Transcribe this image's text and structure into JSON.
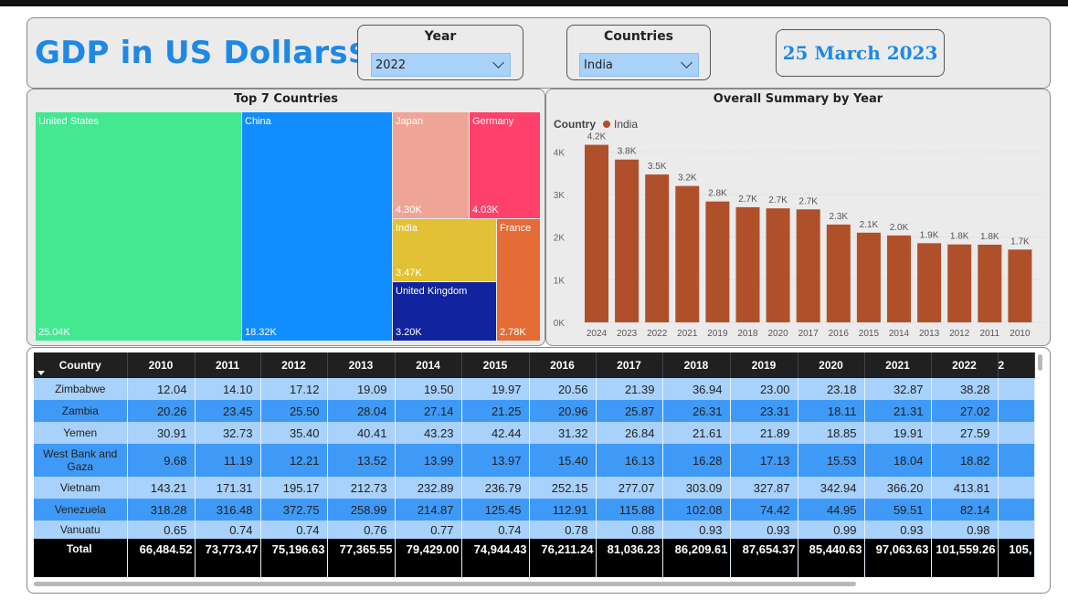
{
  "header": {
    "title": "GDP in US Dollars$",
    "date": "25 March 2023",
    "year_slicer": {
      "label": "Year",
      "value": "2022"
    },
    "country_slicer": {
      "label": "Countries",
      "value": "India"
    }
  },
  "treemap": {
    "title": "Top 7 Countries",
    "tiles": [
      {
        "name": "United States",
        "value": "25.04K",
        "color": "#43e891"
      },
      {
        "name": "China",
        "value": "18.32K",
        "color": "#118dff"
      },
      {
        "name": "Japan",
        "value": "4.30K",
        "color": "#eea597"
      },
      {
        "name": "Germany",
        "value": "4.03K",
        "color": "#ff416c"
      },
      {
        "name": "India",
        "value": "3.47K",
        "color": "#e2c134"
      },
      {
        "name": "United Kingdom",
        "value": "3.20K",
        "color": "#12239e"
      },
      {
        "name": "France",
        "value": "2.78K",
        "color": "#e66c37"
      }
    ]
  },
  "chart_data": {
    "type": "bar",
    "title": "Overall Summary by Year",
    "legend_title": "Country",
    "series": [
      {
        "name": "India",
        "color": "#b0502a",
        "values": [
          4166,
          3820,
          3470,
          3200,
          2836,
          2702,
          2675,
          2651,
          2295,
          2104,
          2039,
          1857,
          1828,
          1823,
          1708
        ]
      }
    ],
    "categories": [
      "2024",
      "2023",
      "2022",
      "2021",
      "2019",
      "2018",
      "2020",
      "2017",
      "2016",
      "2015",
      "2014",
      "2013",
      "2012",
      "2011",
      "2010"
    ],
    "data_labels": [
      "4.2K",
      "3.8K",
      "3.5K",
      "3.2K",
      "2.8K",
      "2.7K",
      "2.7K",
      "2.7K",
      "2.3K",
      "2.1K",
      "2.0K",
      "1.9K",
      "1.8K",
      "1.8K",
      "1.7K"
    ],
    "y_ticks": [
      "0K",
      "1K",
      "2K",
      "3K",
      "4K"
    ],
    "ylim": [
      0,
      4500
    ],
    "grid": true
  },
  "table": {
    "corner_label": "Country",
    "columns": [
      "2010",
      "2011",
      "2012",
      "2013",
      "2014",
      "2015",
      "2016",
      "2017",
      "2018",
      "2019",
      "2020",
      "2021",
      "2022",
      "2"
    ],
    "rows": [
      {
        "country": "Zimbabwe",
        "values": [
          "12.04",
          "14.10",
          "17.12",
          "19.09",
          "19.50",
          "19.97",
          "20.56",
          "21.39",
          "36.94",
          "23.00",
          "23.18",
          "32.87",
          "38.28",
          ""
        ]
      },
      {
        "country": "Zambia",
        "values": [
          "20.26",
          "23.45",
          "25.50",
          "28.04",
          "27.14",
          "21.25",
          "20.96",
          "25.87",
          "26.31",
          "23.31",
          "18.11",
          "21.31",
          "27.02",
          ""
        ]
      },
      {
        "country": "Yemen",
        "values": [
          "30.91",
          "32.73",
          "35.40",
          "40.41",
          "43.23",
          "42.44",
          "31.32",
          "26.84",
          "21.61",
          "21.89",
          "18.85",
          "19.91",
          "27.59",
          ""
        ]
      },
      {
        "country": "West Bank and Gaza",
        "values": [
          "9.68",
          "11.19",
          "12.21",
          "13.52",
          "13.99",
          "13.97",
          "15.40",
          "16.13",
          "16.28",
          "17.13",
          "15.53",
          "18.04",
          "18.82",
          ""
        ]
      },
      {
        "country": "Vietnam",
        "values": [
          "143.21",
          "171.31",
          "195.17",
          "212.73",
          "232.89",
          "236.79",
          "252.15",
          "277.07",
          "303.09",
          "327.87",
          "342.94",
          "366.20",
          "413.81",
          ""
        ]
      },
      {
        "country": "Venezuela",
        "values": [
          "318.28",
          "316.48",
          "372.75",
          "258.99",
          "214.87",
          "125.45",
          "112.91",
          "115.88",
          "102.08",
          "74.42",
          "44.95",
          "59.51",
          "82.14",
          ""
        ]
      },
      {
        "country": "Vanuatu",
        "values": [
          "0.65",
          "0.74",
          "0.74",
          "0.76",
          "0.77",
          "0.74",
          "0.78",
          "0.88",
          "0.93",
          "0.93",
          "0.99",
          "0.93",
          "0.98",
          ""
        ]
      }
    ],
    "total": {
      "label": "Total",
      "values": [
        "66,484.52",
        "73,773.47",
        "75,196.63",
        "77,365.55",
        "79,429.00",
        "74,944.43",
        "76,211.24",
        "81,036.23",
        "86,209.61",
        "87,654.37",
        "85,440.63",
        "97,063.63",
        "101,559.26",
        "105,"
      ]
    }
  }
}
